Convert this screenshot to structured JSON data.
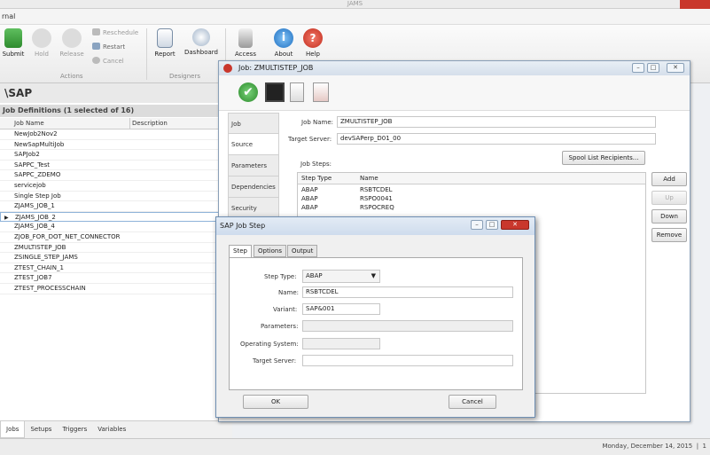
{
  "app": {
    "title": "JAMS",
    "menu_label": "rnal"
  },
  "ribbon": {
    "actions": {
      "submit": "Submit",
      "hold": "Hold",
      "release": "Release",
      "reschedule": "Reschedule",
      "restart": "Restart",
      "cancel": "Cancel",
      "group": "Actions"
    },
    "designers": {
      "report": "Report",
      "dashboard": "Dashboard",
      "group": "Designers"
    },
    "access": "Access",
    "about": "About",
    "help": "Help"
  },
  "left": {
    "path": "\\SAP",
    "section_title": "Job Definitions (1 selected of 16)",
    "columns": [
      "Job Name",
      "Description"
    ],
    "jobs": [
      "NewJob2Nov2",
      "NewSapMultiJob",
      "SAPJob2",
      "SAPPC_Test",
      "SAPPC_ZDEMO",
      "servicejob",
      "Single Step Job",
      "ZJAMS_JOB_1",
      "ZJAMS_JOB_2",
      "ZJAMS_JOB_4",
      "ZJOB_FOR_DOT_NET_CONNECTOR",
      "ZMULTISTEP_JOB",
      "ZSINGLE_STEP_JAMS",
      "ZTEST_CHAIN_1",
      "ZTEST_JOB7",
      "ZTEST_PROCESSCHAIN"
    ],
    "selected_index": 8,
    "tabs": [
      "Jobs",
      "Setups",
      "Triggers",
      "Variables"
    ]
  },
  "job_window": {
    "title": "Job: ZMULTISTEP_JOB",
    "tabs": [
      "Job",
      "Source",
      "Parameters",
      "Dependencies",
      "Security"
    ],
    "job_name_label": "Job Name:",
    "job_name": "ZMULTISTEP_JOB",
    "target_server_label": "Target Server:",
    "target_server": "devSAPerp_D01_00",
    "spool_button": "Spool List Recipients...",
    "steps_label": "Job Steps:",
    "steps_columns": [
      "Step Type",
      "Name"
    ],
    "steps": [
      {
        "type": "ABAP",
        "name": "RSBTCDEL"
      },
      {
        "type": "ABAP",
        "name": "RSPO0041"
      },
      {
        "type": "ABAP",
        "name": "RSPOCREQ"
      }
    ],
    "buttons": {
      "add": "Add",
      "up": "Up",
      "down": "Down",
      "remove": "Remove"
    }
  },
  "dialog": {
    "title": "SAP Job Step",
    "tabs": [
      "Step",
      "Options",
      "Output"
    ],
    "step_type_label": "Step Type:",
    "step_type": "ABAP",
    "name_label": "Name:",
    "name": "RSBTCDEL",
    "variant_label": "Variant:",
    "variant": "SAP&001",
    "parameters_label": "Parameters:",
    "os_label": "Operating System:",
    "target_server_label": "Target Server:",
    "ok": "OK",
    "cancel": "Cancel"
  },
  "status": {
    "date": "Monday, December 14, 2015",
    "page": "1"
  },
  "colors": {
    "accent": "#c9372c",
    "selection": "#8fb3d9"
  }
}
